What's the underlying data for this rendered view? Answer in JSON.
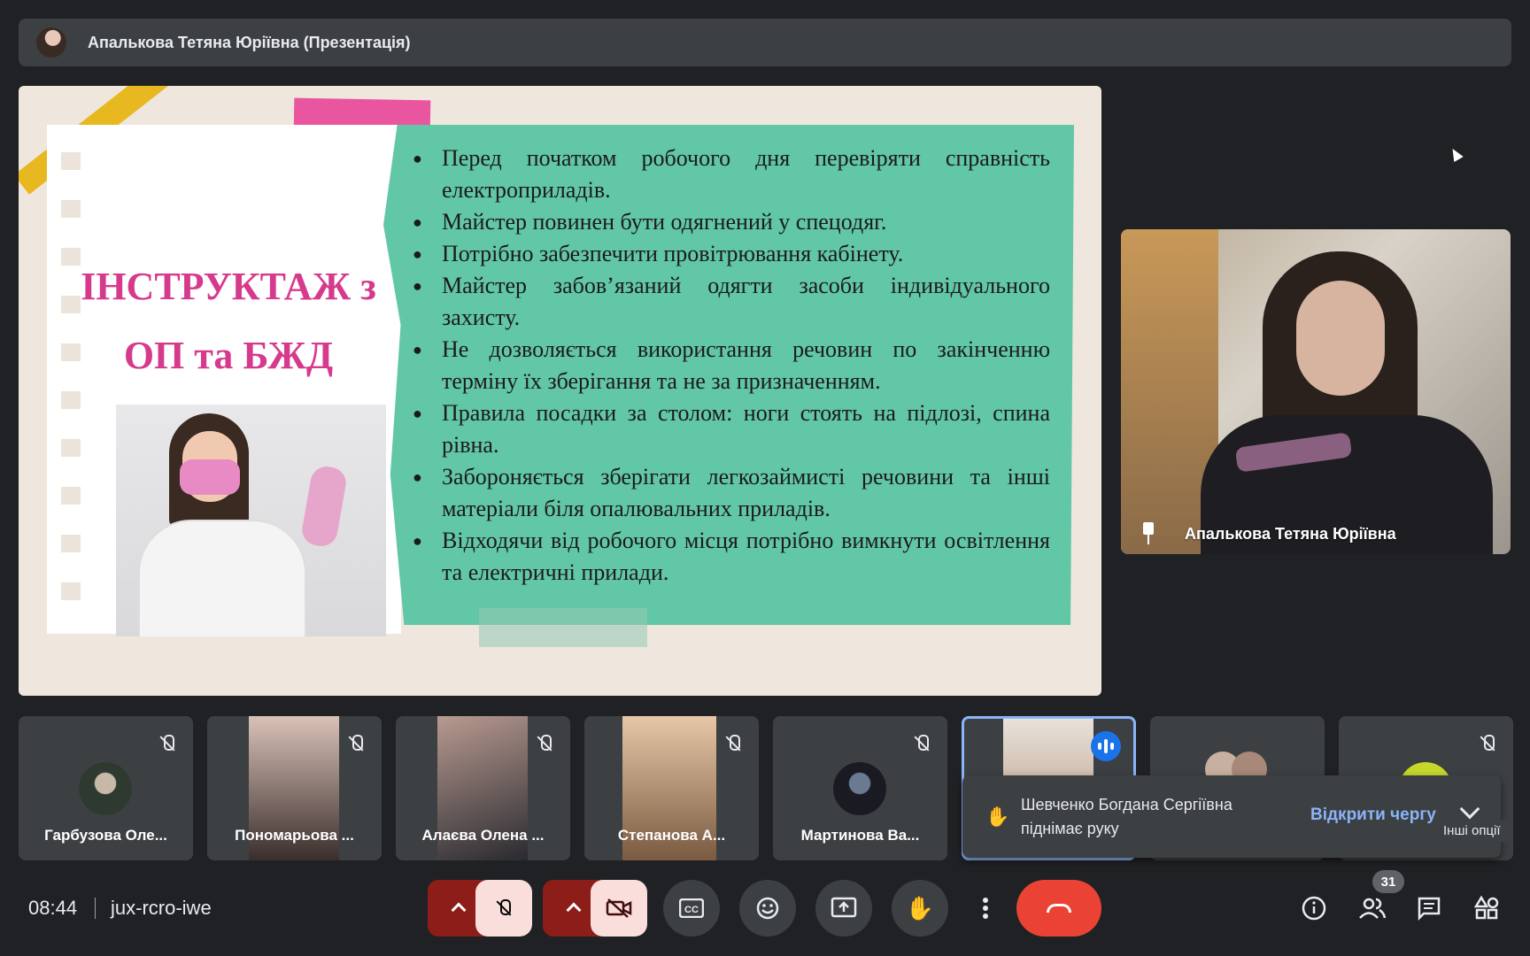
{
  "presentation_bar": {
    "title": "Апалькова Тетяна Юріївна (Презентація)"
  },
  "slide": {
    "title_line1": "ІНСТРУКТАЖ з",
    "title_line2": "ОП та БЖД",
    "bullets": [
      "Перед початком робочого дня перевіряти справність електроприладів.",
      "Майстер повинен бути одягнений у спецодяг.",
      "Потрібно забезпечити провітрювання кабінету.",
      "Майстер забов’язаний одягти засоби індивідуального захисту.",
      "Не дозволяється використання речовин по закінченню терміну їх зберігання та не за призначенням.",
      "Правила посадки за столом: ноги стоять на підлозі, спина рівна.",
      "Забороняється зберігати легкозаймисті речовини та інші матеріали біля опалювальних приладів.",
      "Відходячи від робочого місця потрібно вимкнути освітлення та електричні прилади."
    ]
  },
  "pinned": {
    "name": "Апалькова Тетяна Юріївна"
  },
  "participants": [
    {
      "name": "Гарбузова Оле..."
    },
    {
      "name": "Пономарьова ..."
    },
    {
      "name": "Алаєва Олена ..."
    },
    {
      "name": "Степанова А..."
    },
    {
      "name": "Мартинова Ва..."
    }
  ],
  "toast": {
    "message": "Шевченко Богдана Сергіївна піднімає руку",
    "action": "Відкрити чергу",
    "tooltip": "Інші опції"
  },
  "footer": {
    "time": "08:44",
    "meeting_code": "jux-rcro-iwe",
    "people_count": "31"
  },
  "colors": {
    "accent": "#8ab4f8",
    "end_call": "#ea4335",
    "slide_title": "#d63a8c",
    "slide_green": "#62c7a6"
  }
}
